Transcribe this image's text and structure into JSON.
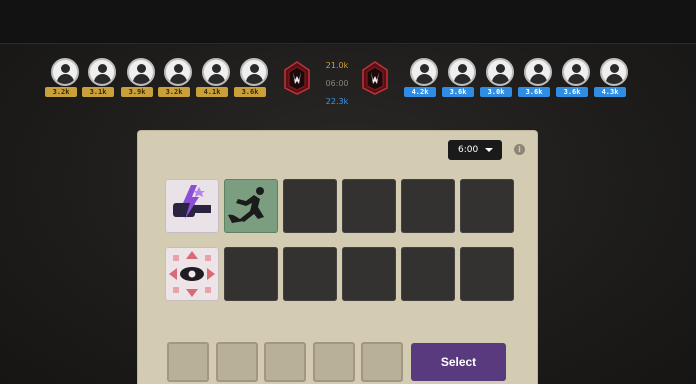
{
  "team_left": {
    "players": [
      {
        "value": "3.2k"
      },
      {
        "value": "3.1k"
      },
      {
        "value": "3.9k"
      },
      {
        "value": "3.2k"
      },
      {
        "value": "4.1k"
      },
      {
        "value": "3.6k"
      }
    ],
    "color": "#c9a03a"
  },
  "team_right": {
    "players": [
      {
        "value": "4.2k"
      },
      {
        "value": "3.6k"
      },
      {
        "value": "3.0k"
      },
      {
        "value": "3.6k"
      },
      {
        "value": "3.6k"
      },
      {
        "value": "4.3k"
      }
    ],
    "color": "#2f8de4"
  },
  "scores": {
    "left_total": "21.0k",
    "timer": "06:00",
    "right_total": "22.3k"
  },
  "panel": {
    "time_select": "6:00",
    "info_icon": "i",
    "select_label": "Select",
    "filled_cards": [
      "lightning-fist-icon",
      "runner-icon",
      "eye-icon"
    ],
    "accent": "#5a3a7e"
  }
}
